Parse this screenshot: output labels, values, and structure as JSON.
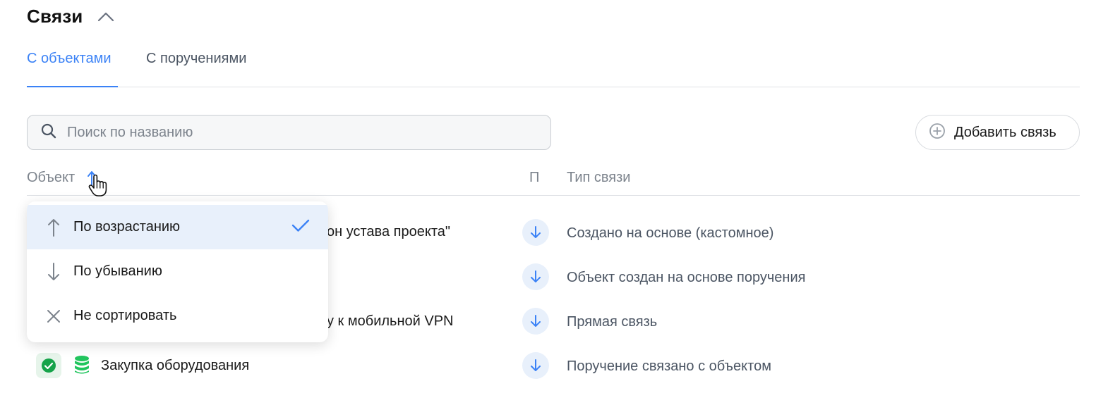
{
  "section": {
    "title": "Связи"
  },
  "tabs": [
    {
      "label": "С объектами",
      "active": true
    },
    {
      "label": "С поручениями",
      "active": false
    }
  ],
  "search": {
    "placeholder": "Поиск по названию",
    "value": ""
  },
  "add_button": {
    "label": "Добавить связь",
    "icon": "plus-circle-icon"
  },
  "columns": {
    "object": "Объект",
    "p": "П",
    "type": "Тип связи"
  },
  "rows": [
    {
      "name": "он устава проекта\"",
      "type": "Создано на основе (кастомное)",
      "direction_icon": "arrow-down-icon"
    },
    {
      "name": "",
      "type": "Объект создан на основе поручения",
      "direction_icon": "arrow-down-icon"
    },
    {
      "name": "у к мобильной VPN",
      "type": "Прямая связь",
      "direction_icon": "arrow-down-icon"
    },
    {
      "name": "Закупка оборудования",
      "type": "Поручение связано с объектом",
      "direction_icon": "arrow-down-icon"
    }
  ],
  "sort_menu": {
    "items": [
      {
        "label": "По возрастанию",
        "icon": "arrow-up-icon",
        "selected": true
      },
      {
        "label": "По убыванию",
        "icon": "arrow-down-icon",
        "selected": false
      },
      {
        "label": "Не сортировать",
        "icon": "close-icon",
        "selected": false
      }
    ]
  },
  "colors": {
    "accent": "#3b82f6",
    "success": "#16a34a",
    "muted": "#7c838c"
  }
}
